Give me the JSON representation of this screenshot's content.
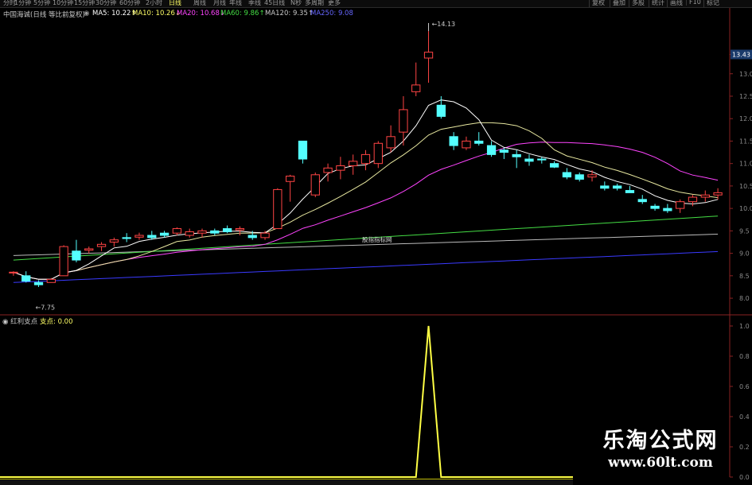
{
  "toolbar": {
    "periods": [
      "分时",
      "1分钟",
      "5分钟",
      "10分钟",
      "15分钟",
      "30分钟",
      "60分钟",
      "2小时",
      "日线",
      "周线",
      "月线",
      "年线",
      "季线",
      "45日线",
      "N秒",
      "多周期",
      "更多"
    ],
    "active_period": "日线",
    "right_buttons": [
      "复权",
      "叠加",
      "多股",
      "统计",
      "画线",
      "F10",
      "标记"
    ],
    "colors": {
      "active": "#ffff66"
    }
  },
  "main": {
    "stock_name": "中国海诚(日线 等比前复权)",
    "ma_items": [
      {
        "label": "MA5: 10.22",
        "arrow": "↑",
        "color": "#ffffff"
      },
      {
        "label": "MA10: 10.26",
        "arrow": "↓",
        "color": "#ffff66"
      },
      {
        "label": "MA20: 10.68",
        "arrow": "↓",
        "color": "#ff44ff"
      },
      {
        "label": "MA60: 9.86",
        "arrow": "↑",
        "color": "#44dd44"
      },
      {
        "label": "MA120: 9.35",
        "arrow": "↑",
        "color": "#c8c8c8"
      },
      {
        "label": "MA250: 9.08",
        "arrow": "",
        "color": "#6666ff"
      }
    ],
    "annotations": {
      "high": "14.13",
      "low": "7.75",
      "center_label": "股指指标网"
    },
    "price_axis": [
      "13.43",
      "13.0",
      "12.5",
      "12.0",
      "11.5",
      "11.0",
      "10.5",
      "10.0",
      "9.5",
      "9.0",
      "8.5",
      "8.0"
    ],
    "current_price": "13.43"
  },
  "sub": {
    "indicator_name": "红利支点",
    "value_label": "支点: 0.00",
    "axis": [
      "1.0",
      "0.8",
      "0.6",
      "0.4",
      "0.2",
      "0.0"
    ]
  },
  "watermark": {
    "title": "乐淘公式网",
    "url": "www.60lt.com"
  },
  "chart_data": {
    "type": "candlestick",
    "ohlc": [
      [
        8.58,
        8.6,
        8.5,
        8.58
      ],
      [
        8.5,
        8.6,
        8.35,
        8.38
      ],
      [
        8.35,
        8.4,
        8.25,
        8.3
      ],
      [
        8.35,
        8.45,
        8.35,
        8.42
      ],
      [
        8.5,
        9.18,
        8.5,
        9.15
      ],
      [
        9.05,
        9.3,
        8.8,
        8.85
      ],
      [
        9.07,
        9.15,
        9.0,
        9.1
      ],
      [
        9.15,
        9.25,
        9.05,
        9.2
      ],
      [
        9.25,
        9.35,
        9.15,
        9.3
      ],
      [
        9.35,
        9.45,
        9.25,
        9.33
      ],
      [
        9.36,
        9.46,
        9.3,
        9.4
      ],
      [
        9.4,
        9.5,
        9.3,
        9.35
      ],
      [
        9.45,
        9.5,
        9.35,
        9.4
      ],
      [
        9.45,
        9.58,
        9.4,
        9.55
      ],
      [
        9.4,
        9.55,
        9.35,
        9.48
      ],
      [
        9.45,
        9.55,
        9.35,
        9.5
      ],
      [
        9.5,
        9.55,
        9.4,
        9.45
      ],
      [
        9.55,
        9.62,
        9.45,
        9.48
      ],
      [
        9.52,
        9.6,
        9.4,
        9.55
      ],
      [
        9.4,
        9.5,
        9.3,
        9.35
      ],
      [
        9.35,
        9.5,
        9.3,
        9.45
      ],
      [
        9.55,
        10.45,
        9.55,
        10.42
      ],
      [
        10.6,
        10.75,
        10.15,
        10.72
      ],
      [
        11.5,
        11.5,
        11.0,
        11.1
      ],
      [
        10.3,
        10.8,
        10.25,
        10.75
      ],
      [
        10.8,
        11.0,
        10.6,
        10.9
      ],
      [
        10.85,
        11.15,
        10.65,
        10.95
      ],
      [
        10.95,
        11.2,
        10.75,
        11.05
      ],
      [
        11.0,
        11.3,
        10.85,
        11.2
      ],
      [
        11.0,
        11.5,
        10.9,
        11.45
      ],
      [
        11.35,
        11.85,
        11.25,
        11.6
      ],
      [
        11.7,
        12.5,
        11.4,
        12.2
      ],
      [
        12.6,
        13.25,
        12.5,
        12.75
      ],
      [
        13.35,
        13.95,
        12.8,
        13.48
      ],
      [
        12.3,
        12.5,
        12.0,
        12.05
      ],
      [
        11.6,
        11.7,
        11.3,
        11.4
      ],
      [
        11.35,
        11.6,
        11.3,
        11.5
      ],
      [
        11.5,
        11.7,
        11.4,
        11.45
      ],
      [
        11.4,
        11.5,
        11.15,
        11.2
      ],
      [
        11.3,
        11.35,
        11.1,
        11.25
      ],
      [
        11.2,
        11.3,
        10.9,
        11.15
      ],
      [
        11.1,
        11.2,
        10.95,
        11.05
      ],
      [
        11.1,
        11.15,
        11.0,
        11.08
      ],
      [
        11.0,
        11.05,
        10.9,
        10.92
      ],
      [
        10.8,
        10.9,
        10.65,
        10.7
      ],
      [
        10.75,
        10.8,
        10.6,
        10.65
      ],
      [
        10.7,
        10.85,
        10.6,
        10.75
      ],
      [
        10.5,
        10.6,
        10.4,
        10.45
      ],
      [
        10.5,
        10.55,
        10.4,
        10.45
      ],
      [
        10.4,
        10.5,
        10.35,
        10.35
      ],
      [
        10.2,
        10.3,
        10.1,
        10.15
      ],
      [
        10.05,
        10.1,
        9.95,
        10.0
      ],
      [
        10.0,
        10.1,
        9.9,
        9.95
      ],
      [
        10.0,
        10.2,
        9.9,
        10.15
      ],
      [
        10.15,
        10.3,
        10.05,
        10.25
      ],
      [
        10.25,
        10.4,
        10.15,
        10.3
      ],
      [
        10.3,
        10.45,
        10.2,
        10.35
      ]
    ],
    "sub_signal": {
      "peak_index": 33,
      "peak_value": 1.0,
      "base_value": 0.0
    },
    "ylim": [
      7.7,
      14.2
    ]
  }
}
